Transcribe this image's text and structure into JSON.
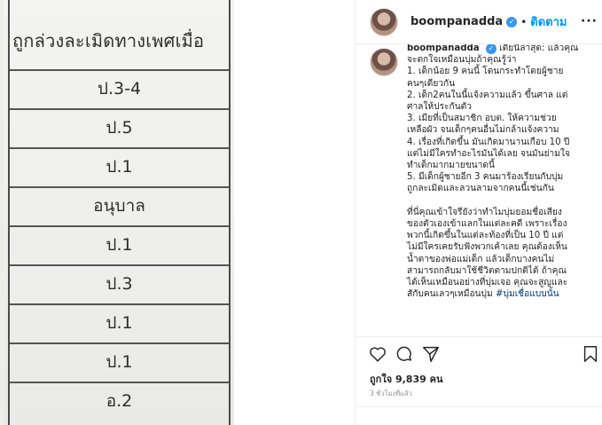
{
  "photo": {
    "header": "ถูกล่วงละเมิดทางเพศเมื่อ",
    "rows": [
      "ป.3-4",
      "ป.5",
      "ป.1",
      "อนุบาล",
      "ป.1",
      "ป.3",
      "ป.1",
      "ป.1",
      "อ.2"
    ]
  },
  "post": {
    "username": "boompanadda",
    "dot": "•",
    "follow_label": "ติดตาม",
    "more_label": "···",
    "caption_username": "boompanadda",
    "caption_lines": [
      "เดี๋ยนี้ล่าสุด: แล้วคุณ",
      "จะตกใจเหมือนบุ่มถ้าคุณรู้ว่า",
      "1. เด็กน้อย 9 คนนี้ โดนกระทำโดยผู้ชาย",
      "คนๆเดียวกัน",
      "2. เด็ก2คนในนี้แจ้งความแล้ว ขึ้นศาล แต่",
      "ศาลให้ประกันตัว",
      "3. เมียที่เป็นสมาชิก อบต. ให้ความช่วย",
      "เหลือผัว จนเด็กๆคนอื่นไม่กล้าแจ้งความ",
      "4. เรื่องที่เกิดขึ้น มันเกิดมานานเกือบ 10 ปี",
      "แต่ไม่มีใครทำอะไรมันได้เลย จนมันย่ามใจ",
      "ทำเด็กมากมายขนาดนี้",
      "5. มีเด็กผู้ชายอีก 3 คนมาร้องเรียนกับบุ่ม",
      "ถูกละเมิดและลวนลามจากคนนี้เช่นกัน",
      "",
      "ที่นี่คุณเข้าใจรึยังว่าทำไมบุ่มยอมชื่อเสียง",
      "ของตัวเองเข้าแลกในแต่ละคดี เพราะเรื่อง",
      "พวกนี้เกิดขึ้นในแต่ละท้องที่เป็น 10 ปี แต่",
      "ไม่มีใครเคยรับฟังพวกเค้าเลย คุณต้องเห็น",
      "น้ำตาของพ่อแม่เด็ก แล้วเด็กบางคนไม่",
      "สามารถกลับมาใช้ชีวิตตามปกติได้ ถ้าคุณ",
      "ได้เห็นเหมือนอย่างที่บุ่มเจอ คุณจะสูญและ",
      "สักับคนเลวๆเหมือนบุ่ม"
    ],
    "hashtag": "#บุ่มเชื่อแบบนั้น",
    "likes": "ถูกใจ 9,839 คน",
    "time": "3 ชั่วโมงที่แล้ว",
    "icons": [
      "heart-icon",
      "comment-icon",
      "share-icon",
      "bookmark-icon"
    ],
    "colors": {
      "accent": "#0095f6",
      "verified": "#3897f0",
      "hashtag": "#00376b"
    }
  }
}
